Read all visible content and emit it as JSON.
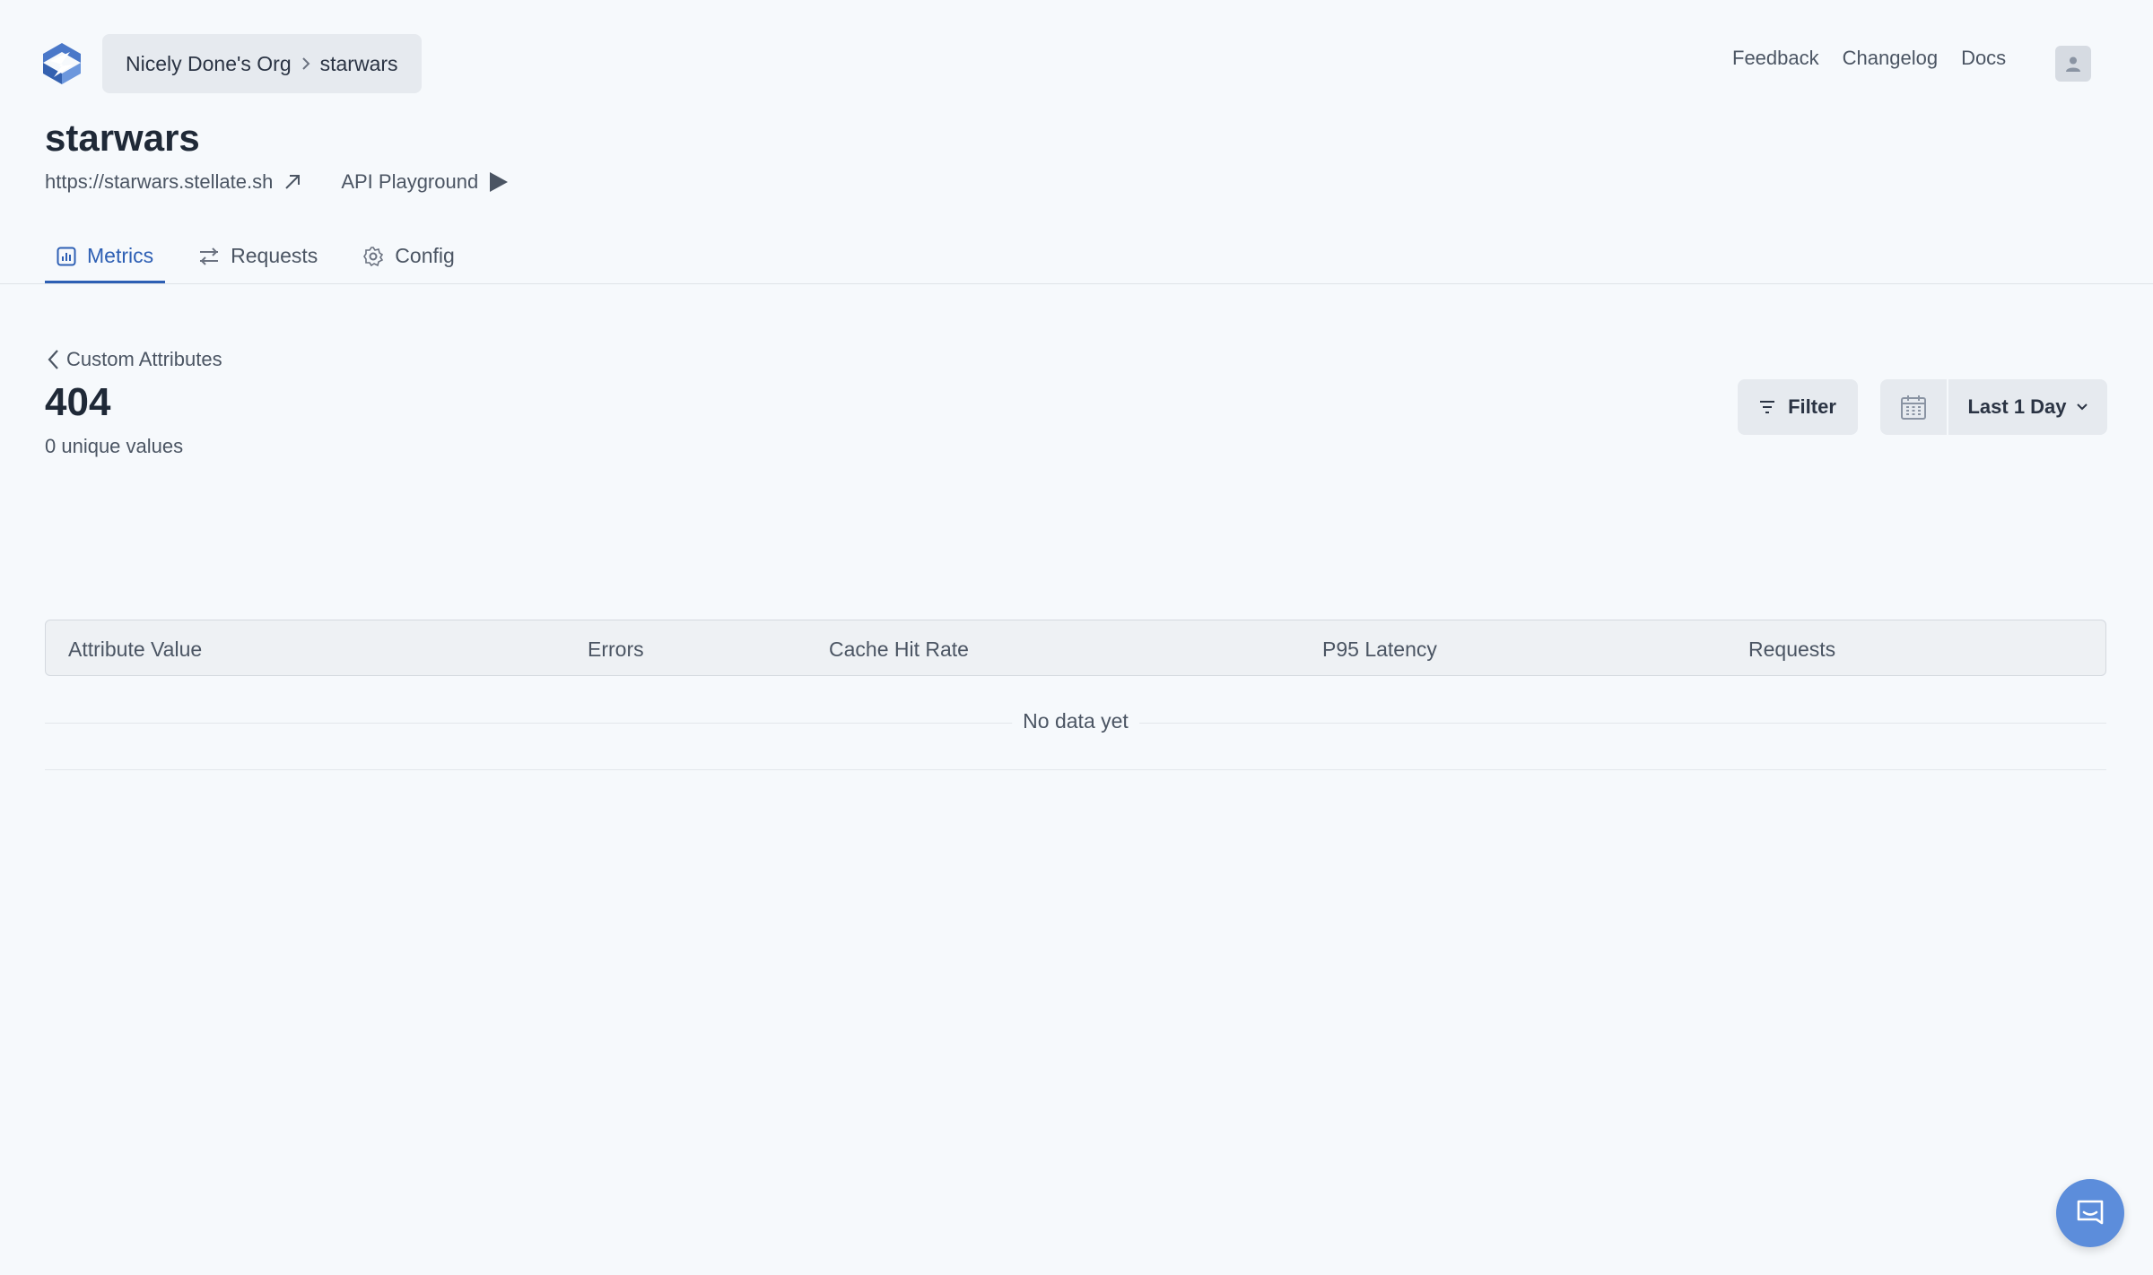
{
  "header": {
    "breadcrumb": {
      "org": "Nicely Done's Org",
      "project": "starwars"
    },
    "nav": {
      "feedback": "Feedback",
      "changelog": "Changelog",
      "docs": "Docs"
    }
  },
  "project": {
    "title": "starwars",
    "url": "https://starwars.stellate.sh",
    "playground_label": "API Playground"
  },
  "tabs": [
    {
      "label": "Metrics",
      "icon": "chart-icon",
      "active": true
    },
    {
      "label": "Requests",
      "icon": "sliders-icon",
      "active": false
    },
    {
      "label": "Config",
      "icon": "gear-icon",
      "active": false
    }
  ],
  "metric": {
    "back_label": "Custom Attributes",
    "title": "404",
    "subtitle": "0 unique values"
  },
  "controls": {
    "filter_label": "Filter",
    "date_range": "Last 1 Day"
  },
  "table": {
    "columns": [
      "Attribute Value",
      "Errors",
      "Cache Hit Rate",
      "P95 Latency",
      "Requests"
    ],
    "empty_text": "No data yet"
  },
  "colors": {
    "accent": "#2d5fb4",
    "chat": "#5c8ddb",
    "background": "#f6f9fc"
  }
}
